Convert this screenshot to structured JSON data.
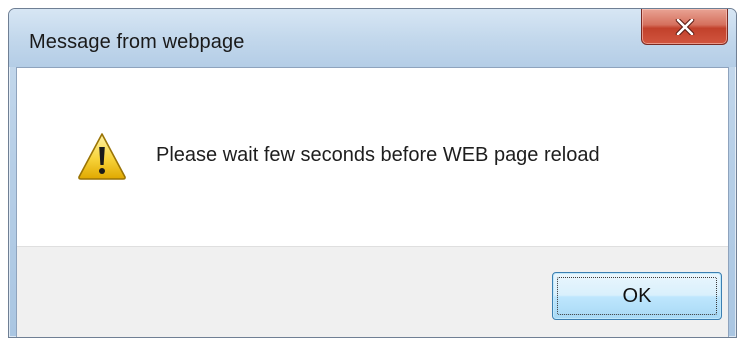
{
  "dialog": {
    "title": "Message from webpage",
    "message": "Please wait few seconds before WEB page reload",
    "ok_label": "OK",
    "close_glyph": "x",
    "icon": "warning-icon"
  },
  "colors": {
    "close_button": "#c7462f",
    "ok_button_border": "#3c7fb1",
    "footer_background": "#f0f0f0",
    "warning_yellow": "#f4c623"
  }
}
